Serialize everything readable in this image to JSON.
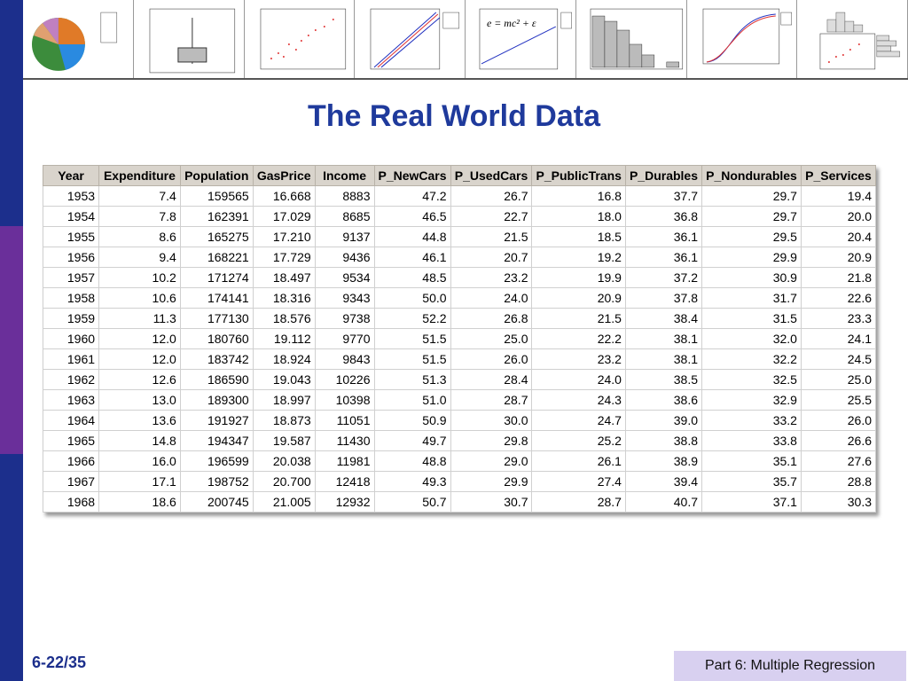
{
  "title": "The Real World Data",
  "page_number": "6-22/35",
  "footer_label": "Part 6: Multiple Regression",
  "equation": "e = mc² + ε",
  "colors": {
    "title": "#1f3a9c",
    "bar_blue": "#1c2f8c",
    "bar_purple": "#6a2f9a",
    "footer_bg": "#d8d0f0"
  },
  "table": {
    "headers": [
      "Year",
      "Expenditure",
      "Population",
      "GasPrice",
      "Income",
      "P_NewCars",
      "P_UsedCars",
      "P_PublicTrans",
      "P_Durables",
      "P_Nondurables",
      "P_Services"
    ],
    "rows": [
      [
        "1953",
        "7.4",
        "159565",
        "16.668",
        "8883",
        "47.2",
        "26.7",
        "16.8",
        "37.7",
        "29.7",
        "19.4"
      ],
      [
        "1954",
        "7.8",
        "162391",
        "17.029",
        "8685",
        "46.5",
        "22.7",
        "18.0",
        "36.8",
        "29.7",
        "20.0"
      ],
      [
        "1955",
        "8.6",
        "165275",
        "17.210",
        "9137",
        "44.8",
        "21.5",
        "18.5",
        "36.1",
        "29.5",
        "20.4"
      ],
      [
        "1956",
        "9.4",
        "168221",
        "17.729",
        "9436",
        "46.1",
        "20.7",
        "19.2",
        "36.1",
        "29.9",
        "20.9"
      ],
      [
        "1957",
        "10.2",
        "171274",
        "18.497",
        "9534",
        "48.5",
        "23.2",
        "19.9",
        "37.2",
        "30.9",
        "21.8"
      ],
      [
        "1958",
        "10.6",
        "174141",
        "18.316",
        "9343",
        "50.0",
        "24.0",
        "20.9",
        "37.8",
        "31.7",
        "22.6"
      ],
      [
        "1959",
        "11.3",
        "177130",
        "18.576",
        "9738",
        "52.2",
        "26.8",
        "21.5",
        "38.4",
        "31.5",
        "23.3"
      ],
      [
        "1960",
        "12.0",
        "180760",
        "19.112",
        "9770",
        "51.5",
        "25.0",
        "22.2",
        "38.1",
        "32.0",
        "24.1"
      ],
      [
        "1961",
        "12.0",
        "183742",
        "18.924",
        "9843",
        "51.5",
        "26.0",
        "23.2",
        "38.1",
        "32.2",
        "24.5"
      ],
      [
        "1962",
        "12.6",
        "186590",
        "19.043",
        "10226",
        "51.3",
        "28.4",
        "24.0",
        "38.5",
        "32.5",
        "25.0"
      ],
      [
        "1963",
        "13.0",
        "189300",
        "18.997",
        "10398",
        "51.0",
        "28.7",
        "24.3",
        "38.6",
        "32.9",
        "25.5"
      ],
      [
        "1964",
        "13.6",
        "191927",
        "18.873",
        "11051",
        "50.9",
        "30.0",
        "24.7",
        "39.0",
        "33.2",
        "26.0"
      ],
      [
        "1965",
        "14.8",
        "194347",
        "19.587",
        "11430",
        "49.7",
        "29.8",
        "25.2",
        "38.8",
        "33.8",
        "26.6"
      ],
      [
        "1966",
        "16.0",
        "196599",
        "20.038",
        "11981",
        "48.8",
        "29.0",
        "26.1",
        "38.9",
        "35.1",
        "27.6"
      ],
      [
        "1967",
        "17.1",
        "198752",
        "20.700",
        "12418",
        "49.3",
        "29.9",
        "27.4",
        "39.4",
        "35.7",
        "28.8"
      ],
      [
        "1968",
        "18.6",
        "200745",
        "21.005",
        "12932",
        "50.7",
        "30.7",
        "28.7",
        "40.7",
        "37.1",
        "30.3"
      ]
    ]
  }
}
